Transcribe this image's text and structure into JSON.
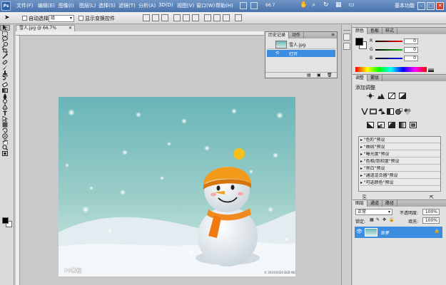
{
  "app": {
    "logo": "Ps",
    "menu": [
      "文件(F)",
      "编辑(E)",
      "图像(I)",
      "图层(L)",
      "选择(S)",
      "滤镜(T)",
      "分析(A)",
      "3D(D)",
      "视图(V)",
      "窗口(W)",
      "帮助(H)"
    ],
    "zoom_value": "66.7",
    "workspace": "基本功能",
    "window_buttons": [
      "–",
      "□",
      "✕"
    ]
  },
  "options": {
    "auto_select_label": "自动选择:",
    "auto_select_value": "组",
    "show_transform_label": "显示变换控件"
  },
  "document": {
    "tab_title": "雪人.jpg @ 66.7%(RGB/8#)",
    "watermark": "PS教程",
    "copyright": "© 2010/2020 BGB INC"
  },
  "history": {
    "tabs": [
      "历史记录",
      "动作"
    ],
    "snapshot_label": "雪人.jpg",
    "step_label": "打开"
  },
  "color_panel": {
    "tabs": [
      "颜色",
      "色板",
      "样式"
    ],
    "channels": [
      {
        "label": "R",
        "value": "0",
        "color": "#cc1010"
      },
      {
        "label": "G",
        "value": "0",
        "color": "#10a010"
      },
      {
        "label": "B",
        "value": "0",
        "color": "#1030d0"
      }
    ]
  },
  "adjustments": {
    "tabs": [
      "调整",
      "蒙版"
    ],
    "title": "添加调整",
    "presets": [
      "\"色阶\"预设",
      "\"曲线\"预设",
      "\"曝光度\"预设",
      "\"色相/饱和度\"预设",
      "\"黑白\"预设",
      "\"通道混合器\"预设",
      "\"可选颜色\"预设"
    ]
  },
  "layers": {
    "tabs": [
      "图层",
      "通道",
      "路径"
    ],
    "blend_mode": "正常",
    "opacity_label": "不透明度:",
    "opacity_value": "100%",
    "lock_label": "锁定:",
    "fill_label": "填充:",
    "fill_value": "100%",
    "layer_name": "背景"
  },
  "colors": {
    "menubar": "#4a73ad",
    "selection": "#3c8de0",
    "foreground": "#000000",
    "background": "#ffffff"
  }
}
